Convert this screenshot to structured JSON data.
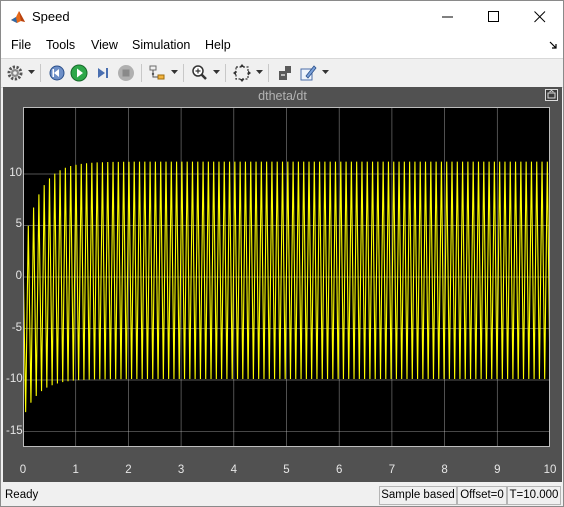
{
  "window": {
    "title": "Speed"
  },
  "menu": [
    "File",
    "Tools",
    "View",
    "Simulation",
    "Help"
  ],
  "toolbar": {
    "buttons": [
      "gear-settings",
      "step-back",
      "run",
      "step-forward",
      "stop",
      "signal-selector",
      "zoom",
      "fit-to-view",
      "cursor-measurements",
      "highlight-simulink-block"
    ]
  },
  "scope": {
    "title": "dtheta/dt",
    "background": "#000000",
    "frame_color": "#515151",
    "trace_color": "#ffff00",
    "grid_color": "#cfcfcf"
  },
  "chart_data": {
    "type": "line",
    "title": "dtheta/dt",
    "xlabel": "",
    "ylabel": "",
    "xlim": [
      0,
      10
    ],
    "ylim": [
      -16.5,
      16.5
    ],
    "xticks": [
      "0",
      "1",
      "2",
      "3",
      "4",
      "5",
      "6",
      "7",
      "8",
      "9",
      "10"
    ],
    "yticks": [
      "10",
      "5",
      "0",
      "-5",
      "-10",
      "-15"
    ],
    "grid": true,
    "series": [
      {
        "signal": "oscillating speed",
        "oscillation_period": 0.1005,
        "steady_state_max": 11.2,
        "steady_state_min": -9.9,
        "initial_min": -13.7,
        "initial_max": 2.5,
        "time_constant": 0.3,
        "x_end": 10
      }
    ]
  },
  "status": {
    "ready": "Ready",
    "sample": "Sample based",
    "offset": "Offset=0",
    "time": "T=10.000"
  }
}
